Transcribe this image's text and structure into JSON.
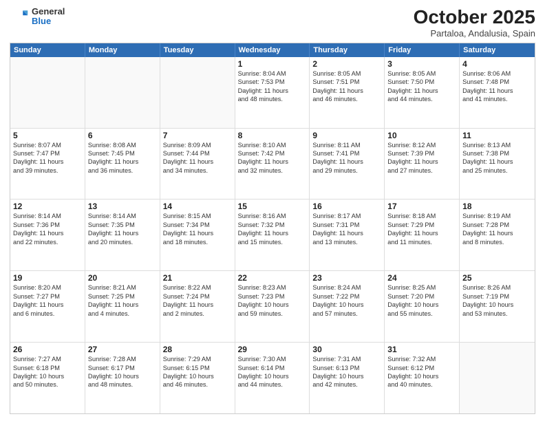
{
  "logo": {
    "general": "General",
    "blue": "Blue"
  },
  "header": {
    "month": "October 2025",
    "location": "Partaloa, Andalusia, Spain"
  },
  "weekdays": [
    "Sunday",
    "Monday",
    "Tuesday",
    "Wednesday",
    "Thursday",
    "Friday",
    "Saturday"
  ],
  "rows": [
    [
      {
        "day": "",
        "lines": []
      },
      {
        "day": "",
        "lines": []
      },
      {
        "day": "",
        "lines": []
      },
      {
        "day": "1",
        "lines": [
          "Sunrise: 8:04 AM",
          "Sunset: 7:53 PM",
          "Daylight: 11 hours",
          "and 48 minutes."
        ]
      },
      {
        "day": "2",
        "lines": [
          "Sunrise: 8:05 AM",
          "Sunset: 7:51 PM",
          "Daylight: 11 hours",
          "and 46 minutes."
        ]
      },
      {
        "day": "3",
        "lines": [
          "Sunrise: 8:05 AM",
          "Sunset: 7:50 PM",
          "Daylight: 11 hours",
          "and 44 minutes."
        ]
      },
      {
        "day": "4",
        "lines": [
          "Sunrise: 8:06 AM",
          "Sunset: 7:48 PM",
          "Daylight: 11 hours",
          "and 41 minutes."
        ]
      }
    ],
    [
      {
        "day": "5",
        "lines": [
          "Sunrise: 8:07 AM",
          "Sunset: 7:47 PM",
          "Daylight: 11 hours",
          "and 39 minutes."
        ]
      },
      {
        "day": "6",
        "lines": [
          "Sunrise: 8:08 AM",
          "Sunset: 7:45 PM",
          "Daylight: 11 hours",
          "and 36 minutes."
        ]
      },
      {
        "day": "7",
        "lines": [
          "Sunrise: 8:09 AM",
          "Sunset: 7:44 PM",
          "Daylight: 11 hours",
          "and 34 minutes."
        ]
      },
      {
        "day": "8",
        "lines": [
          "Sunrise: 8:10 AM",
          "Sunset: 7:42 PM",
          "Daylight: 11 hours",
          "and 32 minutes."
        ]
      },
      {
        "day": "9",
        "lines": [
          "Sunrise: 8:11 AM",
          "Sunset: 7:41 PM",
          "Daylight: 11 hours",
          "and 29 minutes."
        ]
      },
      {
        "day": "10",
        "lines": [
          "Sunrise: 8:12 AM",
          "Sunset: 7:39 PM",
          "Daylight: 11 hours",
          "and 27 minutes."
        ]
      },
      {
        "day": "11",
        "lines": [
          "Sunrise: 8:13 AM",
          "Sunset: 7:38 PM",
          "Daylight: 11 hours",
          "and 25 minutes."
        ]
      }
    ],
    [
      {
        "day": "12",
        "lines": [
          "Sunrise: 8:14 AM",
          "Sunset: 7:36 PM",
          "Daylight: 11 hours",
          "and 22 minutes."
        ]
      },
      {
        "day": "13",
        "lines": [
          "Sunrise: 8:14 AM",
          "Sunset: 7:35 PM",
          "Daylight: 11 hours",
          "and 20 minutes."
        ]
      },
      {
        "day": "14",
        "lines": [
          "Sunrise: 8:15 AM",
          "Sunset: 7:34 PM",
          "Daylight: 11 hours",
          "and 18 minutes."
        ]
      },
      {
        "day": "15",
        "lines": [
          "Sunrise: 8:16 AM",
          "Sunset: 7:32 PM",
          "Daylight: 11 hours",
          "and 15 minutes."
        ]
      },
      {
        "day": "16",
        "lines": [
          "Sunrise: 8:17 AM",
          "Sunset: 7:31 PM",
          "Daylight: 11 hours",
          "and 13 minutes."
        ]
      },
      {
        "day": "17",
        "lines": [
          "Sunrise: 8:18 AM",
          "Sunset: 7:29 PM",
          "Daylight: 11 hours",
          "and 11 minutes."
        ]
      },
      {
        "day": "18",
        "lines": [
          "Sunrise: 8:19 AM",
          "Sunset: 7:28 PM",
          "Daylight: 11 hours",
          "and 8 minutes."
        ]
      }
    ],
    [
      {
        "day": "19",
        "lines": [
          "Sunrise: 8:20 AM",
          "Sunset: 7:27 PM",
          "Daylight: 11 hours",
          "and 6 minutes."
        ]
      },
      {
        "day": "20",
        "lines": [
          "Sunrise: 8:21 AM",
          "Sunset: 7:25 PM",
          "Daylight: 11 hours",
          "and 4 minutes."
        ]
      },
      {
        "day": "21",
        "lines": [
          "Sunrise: 8:22 AM",
          "Sunset: 7:24 PM",
          "Daylight: 11 hours",
          "and 2 minutes."
        ]
      },
      {
        "day": "22",
        "lines": [
          "Sunrise: 8:23 AM",
          "Sunset: 7:23 PM",
          "Daylight: 10 hours",
          "and 59 minutes."
        ]
      },
      {
        "day": "23",
        "lines": [
          "Sunrise: 8:24 AM",
          "Sunset: 7:22 PM",
          "Daylight: 10 hours",
          "and 57 minutes."
        ]
      },
      {
        "day": "24",
        "lines": [
          "Sunrise: 8:25 AM",
          "Sunset: 7:20 PM",
          "Daylight: 10 hours",
          "and 55 minutes."
        ]
      },
      {
        "day": "25",
        "lines": [
          "Sunrise: 8:26 AM",
          "Sunset: 7:19 PM",
          "Daylight: 10 hours",
          "and 53 minutes."
        ]
      }
    ],
    [
      {
        "day": "26",
        "lines": [
          "Sunrise: 7:27 AM",
          "Sunset: 6:18 PM",
          "Daylight: 10 hours",
          "and 50 minutes."
        ]
      },
      {
        "day": "27",
        "lines": [
          "Sunrise: 7:28 AM",
          "Sunset: 6:17 PM",
          "Daylight: 10 hours",
          "and 48 minutes."
        ]
      },
      {
        "day": "28",
        "lines": [
          "Sunrise: 7:29 AM",
          "Sunset: 6:15 PM",
          "Daylight: 10 hours",
          "and 46 minutes."
        ]
      },
      {
        "day": "29",
        "lines": [
          "Sunrise: 7:30 AM",
          "Sunset: 6:14 PM",
          "Daylight: 10 hours",
          "and 44 minutes."
        ]
      },
      {
        "day": "30",
        "lines": [
          "Sunrise: 7:31 AM",
          "Sunset: 6:13 PM",
          "Daylight: 10 hours",
          "and 42 minutes."
        ]
      },
      {
        "day": "31",
        "lines": [
          "Sunrise: 7:32 AM",
          "Sunset: 6:12 PM",
          "Daylight: 10 hours",
          "and 40 minutes."
        ]
      },
      {
        "day": "",
        "lines": []
      }
    ]
  ]
}
